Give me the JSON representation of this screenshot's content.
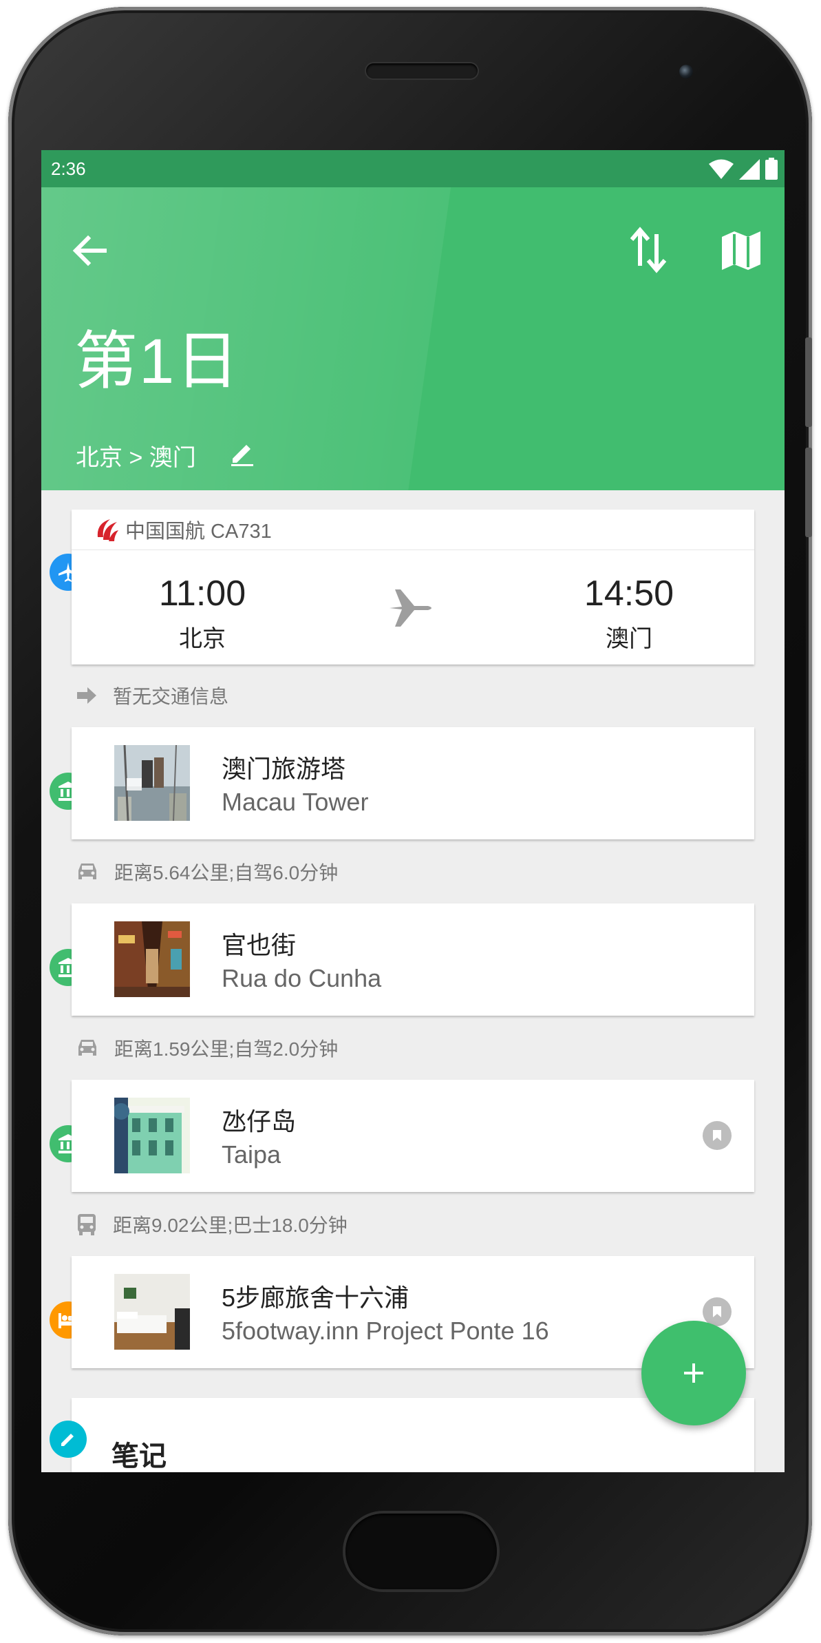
{
  "status_bar": {
    "time": "2:36"
  },
  "header": {
    "title": "第1日",
    "route": "北京 > 澳门",
    "colors": {
      "primary": "#41bd6f",
      "status_bar": "#2f9a5b"
    }
  },
  "flight": {
    "airline": "中国国航 CA731",
    "depart_time": "11:00",
    "depart_city": "北京",
    "arrive_time": "14:50",
    "arrive_city": "澳门"
  },
  "transits": [
    {
      "icon": "arrow-right-icon",
      "text": "暂无交通信息"
    },
    {
      "icon": "car-icon",
      "text": "距离5.64公里;自驾6.0分钟"
    },
    {
      "icon": "car-icon",
      "text": "距离1.59公里;自驾2.0分钟"
    },
    {
      "icon": "bus-icon",
      "text": "距离9.02公里;巴士18.0分钟"
    }
  ],
  "places": [
    {
      "name": "澳门旅游塔",
      "name_en": "Macau Tower",
      "icon": "museum-icon",
      "bookmarked": false
    },
    {
      "name": "官也街",
      "name_en": "Rua do Cunha",
      "icon": "museum-icon",
      "bookmarked": false
    },
    {
      "name": "氹仔岛",
      "name_en": "Taipa",
      "icon": "museum-icon",
      "bookmarked": true
    },
    {
      "name": "5步廊旅舍十六浦",
      "name_en": "5footway.inn Project Ponte 16",
      "icon": "hotel-bed-icon",
      "bookmarked": true
    }
  ],
  "notes": {
    "label": "笔记"
  },
  "fab": {
    "icon": "plus-icon"
  }
}
